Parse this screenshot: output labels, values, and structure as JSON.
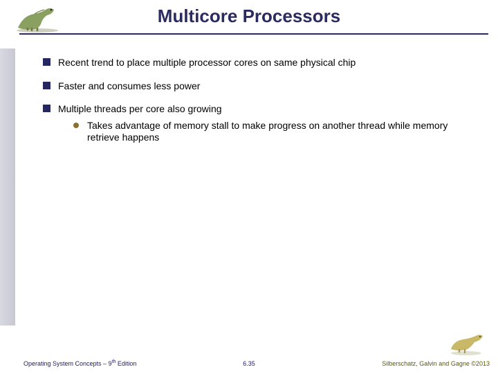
{
  "title": "Multicore Processors",
  "bullets": {
    "b1": "Recent trend to place multiple processor cores on same physical chip",
    "b2": "Faster and consumes less power",
    "b3": "Multiple threads per core also growing",
    "b3_1": "Takes advantage of memory stall to make progress on another thread while memory retrieve happens"
  },
  "footer": {
    "left_a": "Operating System Concepts – 9",
    "left_sup": "th",
    "left_b": " Edition",
    "center": "6.35",
    "right": "Silberschatz, Galvin and Gagne ©2013"
  }
}
